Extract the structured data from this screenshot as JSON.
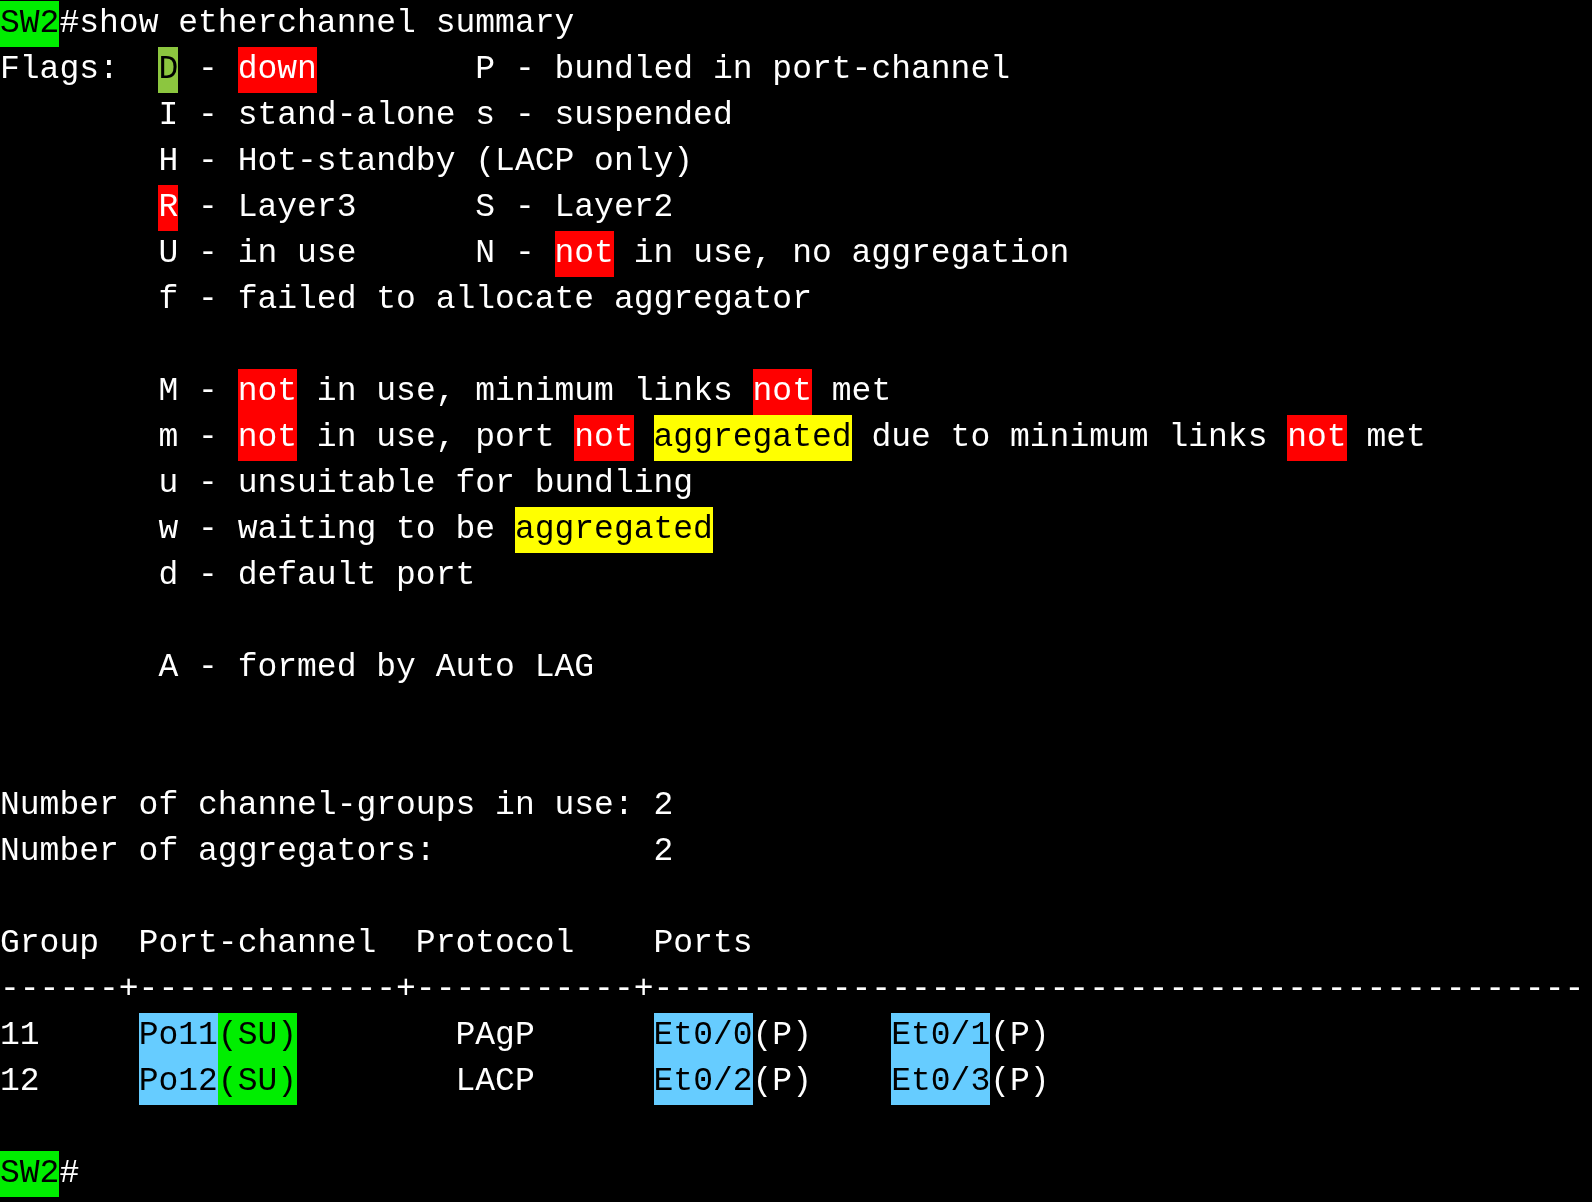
{
  "terminal": {
    "sections": [
      [
        [
          {
            "text": "SW2",
            "color": "#00ee00"
          },
          {
            "text": "#show etherchannel summary"
          }
        ],
        [
          {
            "text": "Flags:  "
          },
          {
            "text": "D",
            "color": "#8cc63f"
          },
          {
            "text": " - "
          },
          {
            "text": "down",
            "color": "#ff0000"
          },
          {
            "text": "        P - bundled in port-channel"
          }
        ],
        [
          {
            "text": "        I - stand-alone s - suspended"
          }
        ],
        [
          {
            "text": "        H - Hot-standby (LACP only)"
          }
        ],
        [
          {
            "text": "R",
            "color": "#ff0000",
            "indented": true
          },
          {
            "text": " - Layer3      S - Layer2"
          }
        ],
        [
          {
            "text": "        U - in use      N - "
          },
          {
            "text": "not",
            "color": "#ff0000"
          },
          {
            "text": " in use, no aggregation"
          }
        ],
        [
          {
            "text": "        f - failed to allocate aggregator"
          }
        ]
      ],
      [
        [
          {
            "text": "        M - "
          },
          {
            "text": "not",
            "color": "#ff0000"
          },
          {
            "text": " in use, minimum links "
          },
          {
            "text": "not",
            "color": "#ff0000"
          },
          {
            "text": " met"
          }
        ],
        [
          {
            "text": "        m - "
          },
          {
            "text": "not",
            "color": "#ff0000"
          },
          {
            "text": " in use, port "
          },
          {
            "text": "not",
            "color": "#ff0000"
          },
          {
            "text": "aggregated",
            "color": "#ffff00",
            "spaced": true
          },
          {
            "text": " due to minimum links "
          },
          {
            "text": "not",
            "color": "#ff0000"
          },
          {
            "text": " met"
          }
        ],
        [
          {
            "text": "        u - unsuitable for bundling"
          }
        ],
        [
          {
            "text": "        w - waiting to be "
          },
          {
            "text": "aggregated",
            "color": "#ffff00"
          }
        ],
        [
          {
            "text": "        d - default port"
          }
        ]
      ],
      [
        [
          {
            "text": "        A - formed by Auto LAG"
          }
        ]
      ],
      [
        [
          {
            "text": "Number of channel-groups in use: 2"
          }
        ],
        [
          {
            "text": "Number of aggregators:           2"
          }
        ]
      ],
      [
        [
          {
            "text": "Group  Port-channel  Protocol    Ports"
          }
        ],
        [
          {
            "text": "------+-------------+-----------+-----------------------------------------------"
          }
        ],
        [
          {
            "text": "11     "
          },
          {
            "text": "Po11",
            "color": "#66ccff"
          },
          {
            "text": "(SU)",
            "color": "#00ee00"
          },
          {
            "text": "        PAgP      "
          },
          {
            "text": "Et0/0",
            "color": "#66ccff"
          },
          {
            "text": "(P)    "
          },
          {
            "text": "Et0/1",
            "color": "#66ccff"
          },
          {
            "text": "(P)"
          }
        ],
        [
          {
            "text": "12     "
          },
          {
            "text": "Po12",
            "color": "#66ccff"
          },
          {
            "text": "(SU)",
            "color": "#00ee00"
          },
          {
            "text": "        LACP      "
          },
          {
            "text": "Et0/2",
            "color": "#66ccff"
          },
          {
            "text": "(P)    "
          },
          {
            "text": "Et0/3",
            "color": "#66ccff"
          },
          {
            "text": "(P)"
          }
        ]
      ],
      [
        [
          {
            "text": "SW2",
            "color": "#00ee00"
          },
          {
            "text": "#"
          }
        ]
      ]
    ]
  }
}
